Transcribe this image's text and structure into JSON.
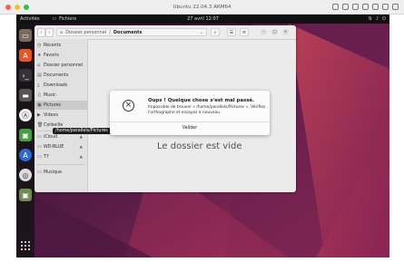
{
  "host": {
    "title": "Ubuntu 22.04.3 ARM64"
  },
  "gnome": {
    "activities": "Activités",
    "app_name": "Fichiers",
    "clock": "27 avril  12:07"
  },
  "files": {
    "path": {
      "home": "Dossier personnel",
      "current": "Documents"
    },
    "sidebar": [
      {
        "icon": "clock-icon",
        "glyph": "◷",
        "label": "Récents"
      },
      {
        "icon": "star-icon",
        "glyph": "★",
        "label": "Favoris"
      },
      {
        "icon": "home-icon",
        "glyph": "⌂",
        "label": "Dossier personnel"
      },
      {
        "icon": "document-icon",
        "glyph": "▤",
        "label": "Documents"
      },
      {
        "icon": "download-icon",
        "glyph": "⤓",
        "label": "Downloads"
      },
      {
        "icon": "music-icon",
        "glyph": "♫",
        "label": "Music"
      },
      {
        "icon": "picture-icon",
        "glyph": "▣",
        "label": "Pictures"
      },
      {
        "icon": "video-icon",
        "glyph": "▶",
        "label": "Videos"
      },
      {
        "icon": "trash-icon",
        "glyph": "🗑",
        "label": "Corbeille"
      },
      {
        "icon": "drive-icon",
        "glyph": "▭",
        "label": "iCloud"
      },
      {
        "icon": "drive-icon",
        "glyph": "▭",
        "label": "WD-BLUE"
      },
      {
        "icon": "drive-icon",
        "glyph": "▭",
        "label": "T7"
      },
      {
        "icon": "folder-icon",
        "glyph": "▭",
        "label": "Musique"
      }
    ],
    "tooltip": "/home/parallels/Pictures",
    "empty_text": "Le dossier est vide"
  },
  "dialog": {
    "title": "Oups ! Quelque chose s'est mal passé.",
    "message": "Impossible de trouver « /home/parallels/Pictures ». Vérifiez l'orthographe et essayez à nouveau.",
    "button": "Valider"
  }
}
